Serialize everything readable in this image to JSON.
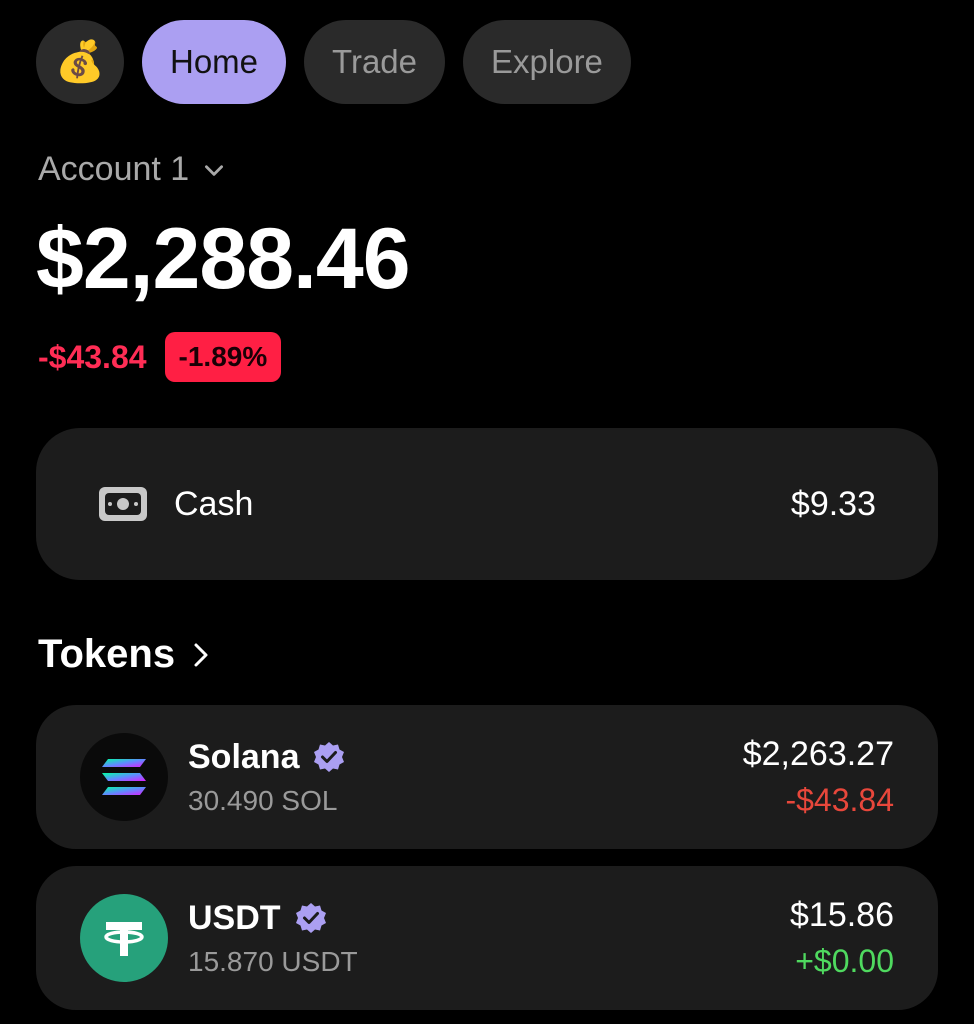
{
  "nav": {
    "avatar_emoji": "💰",
    "tabs": [
      {
        "label": "Home",
        "active": true
      },
      {
        "label": "Trade",
        "active": false
      },
      {
        "label": "Explore",
        "active": false
      }
    ]
  },
  "account": {
    "name": "Account 1",
    "balance": "$2,288.46",
    "change_abs": "-$43.84",
    "change_pct": "-1.89%"
  },
  "cash": {
    "label": "Cash",
    "value": "$9.33"
  },
  "tokens": {
    "title": "Tokens",
    "items": [
      {
        "name": "Solana",
        "amount": "30.490 SOL",
        "value": "$2,263.27",
        "change": "-$43.84",
        "direction": "negative"
      },
      {
        "name": "USDT",
        "amount": "15.870 USDT",
        "value": "$15.86",
        "change": "+$0.00",
        "direction": "positive"
      }
    ]
  },
  "colors": {
    "accent": "#ab9ff2",
    "negative": "#ff2d55",
    "positive": "#4fd95f",
    "card": "#1c1c1c",
    "usdt": "#26a17b"
  }
}
